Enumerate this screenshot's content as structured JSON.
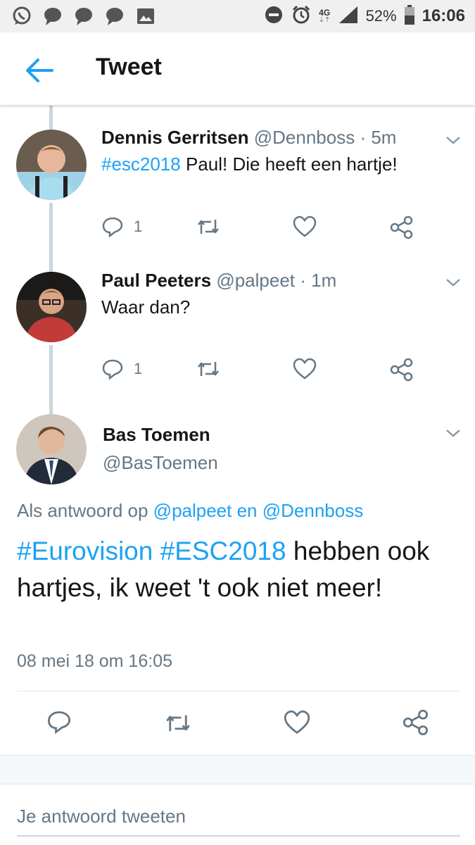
{
  "status_bar": {
    "network": "4G",
    "battery": "52%",
    "time": "16:06",
    "icons": [
      "whatsapp-icon",
      "chat-icon",
      "chat-icon",
      "chat-icon",
      "image-icon",
      "dnd-icon",
      "alarm-icon",
      "signal-icon",
      "battery-icon"
    ]
  },
  "appbar": {
    "title": "Tweet"
  },
  "tweets": [
    {
      "name": "Dennis Gerritsen",
      "handle": "@Dennboss",
      "time": "· 5m",
      "hashtag": "#esc2018",
      "text": " Paul! Die heeft een hartje!",
      "reply_count": "1"
    },
    {
      "name": "Paul Peeters",
      "handle": "@palpeet",
      "time": "· 1m",
      "text": "Waar dan?",
      "reply_count": "1"
    }
  ],
  "main_tweet": {
    "name": "Bas Toemen",
    "handle": "@BasToemen",
    "reply_prefix": "Als antwoord op ",
    "reply_user1": "@palpeet",
    "reply_and": " en ",
    "reply_user2": "@Dennboss",
    "hashtag1": "#Eurovision",
    "hashtag2": "#ESC2018",
    "text": " hebben ook hartjes, ik weet 't ook niet meer!",
    "date": "08 mei 18 om 16:05"
  },
  "reply_box": {
    "placeholder": "Je antwoord tweeten"
  },
  "colors": {
    "accent": "#1da1f2",
    "secondary_text": "#657786",
    "thread_line": "#ccd6dd"
  }
}
